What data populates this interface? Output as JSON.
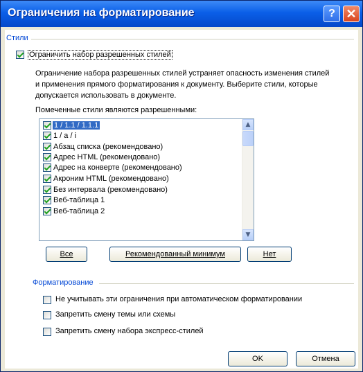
{
  "window": {
    "title": "Ограничения на форматирование"
  },
  "styles_group": {
    "label": "Стили",
    "restrict_checkbox_label": "Ограничить набор разрешенных стилей",
    "restrict_checked": true,
    "description": "Ограничение набора разрешенных стилей устраняет опасность изменения стилей и применения прямого форматирования к документу. Выберите стили, которые допускается использовать в документе.",
    "list_label": "Помеченные стили являются разрешенными:",
    "items": [
      {
        "label": "1 / 1.1 / 1.1.1",
        "checked": true,
        "selected": true
      },
      {
        "label": "1 / a / i",
        "checked": true,
        "selected": false
      },
      {
        "label": "Абзац списка (рекомендовано)",
        "checked": true,
        "selected": false
      },
      {
        "label": "Адрес HTML (рекомендовано)",
        "checked": true,
        "selected": false
      },
      {
        "label": "Адрес на конверте (рекомендовано)",
        "checked": true,
        "selected": false
      },
      {
        "label": "Акроним HTML (рекомендовано)",
        "checked": true,
        "selected": false
      },
      {
        "label": "Без интервала (рекомендовано)",
        "checked": true,
        "selected": false
      },
      {
        "label": "Веб-таблица 1",
        "checked": true,
        "selected": false
      },
      {
        "label": "Веб-таблица 2",
        "checked": true,
        "selected": false
      }
    ],
    "buttons": {
      "all": "Все",
      "recommended_min": "Рекомендованный минимум",
      "none": "Нет"
    }
  },
  "formatting_group": {
    "label": "Форматирование",
    "options": [
      {
        "label": "Не учитывать эти ограничения при автоматическом форматировании",
        "checked": false
      },
      {
        "label": "Запретить смену темы или схемы",
        "checked": false
      },
      {
        "label": "Запретить смену набора экспресс-стилей",
        "checked": false
      }
    ]
  },
  "footer": {
    "ok": "OK",
    "cancel": "Отмена"
  }
}
